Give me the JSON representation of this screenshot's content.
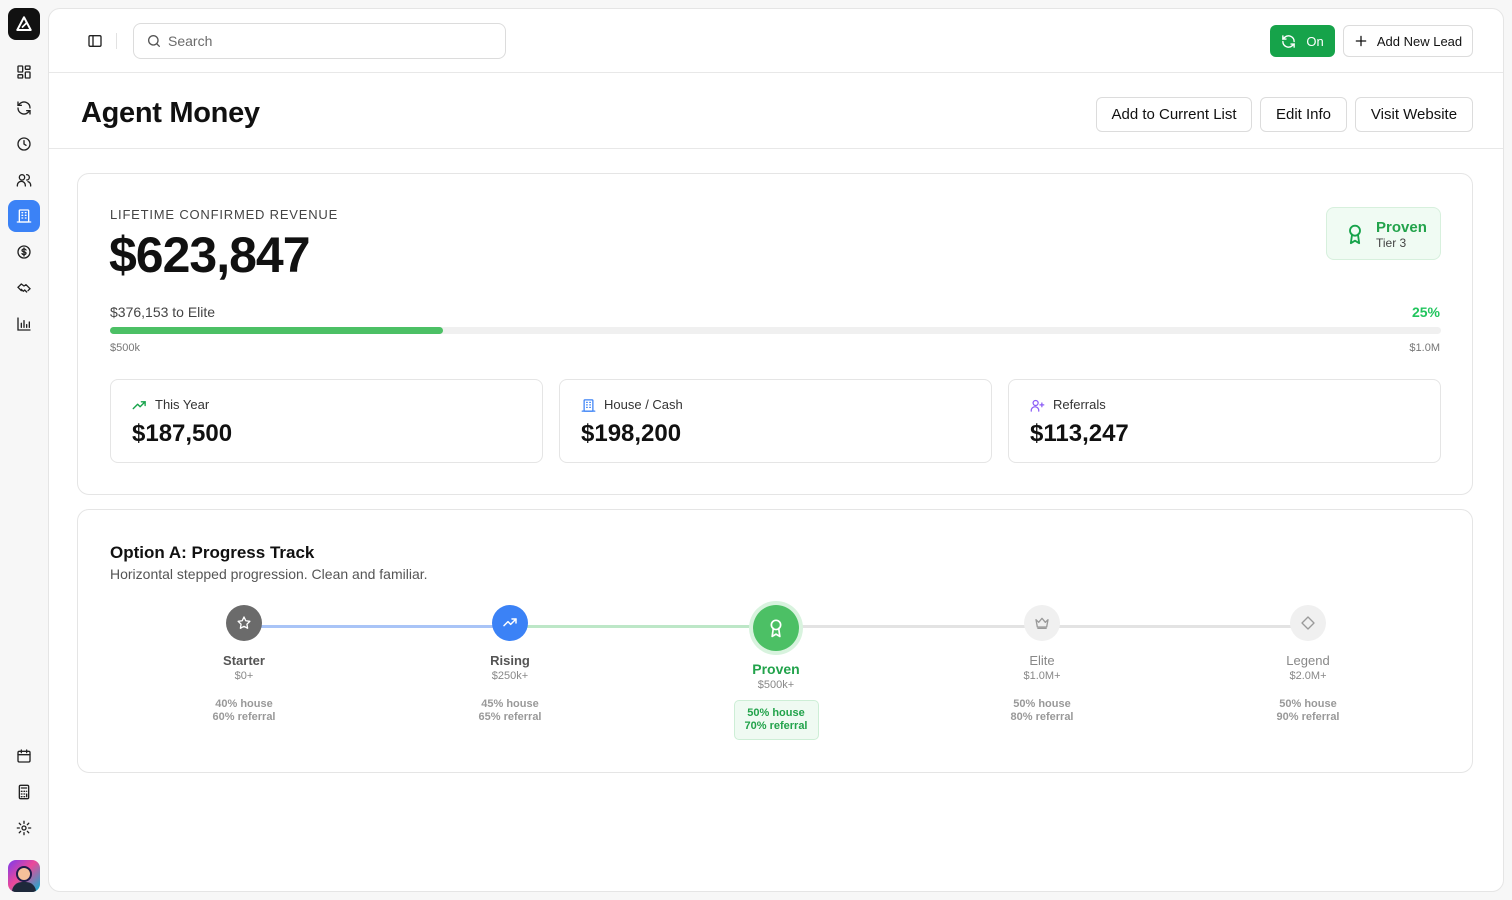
{
  "colors": {
    "accent": "#3b82f6",
    "success": "#16a34a",
    "progress": "#4cc065"
  },
  "sidebar": {
    "items": [
      {
        "icon": "dashboard-icon",
        "active": false
      },
      {
        "icon": "refresh-icon",
        "active": false
      },
      {
        "icon": "clock-icon",
        "active": false
      },
      {
        "icon": "users-icon",
        "active": false
      },
      {
        "icon": "building-icon",
        "active": true
      },
      {
        "icon": "dollar-circle-icon",
        "active": false
      },
      {
        "icon": "handshake-icon",
        "active": false
      },
      {
        "icon": "bar-chart-icon",
        "active": false
      },
      {
        "icon": "calendar-icon",
        "active": false
      },
      {
        "icon": "calculator-icon",
        "active": false
      },
      {
        "icon": "settings-icon",
        "active": false
      }
    ]
  },
  "topbar": {
    "search_placeholder": "Search",
    "sync_label": "On",
    "add_lead_label": "Add New Lead"
  },
  "header": {
    "title": "Agent Money",
    "actions": [
      "Add to Current List",
      "Edit Info",
      "Visit Website"
    ]
  },
  "revenue": {
    "label": "LIFETIME CONFIRMED REVENUE",
    "value": "$623,847",
    "badge_title": "Proven",
    "badge_subtitle": "Tier 3",
    "remaining_text": "$376,153 to Elite",
    "progress_percent_text": "25%",
    "progress_fraction": 0.25,
    "range_start": "$500k",
    "range_end": "$1.0M"
  },
  "stats": [
    {
      "label": "This Year",
      "value": "$187,500",
      "icon": "trending-up-icon"
    },
    {
      "label": "House / Cash",
      "value": "$198,200",
      "icon": "building-icon"
    },
    {
      "label": "Referrals",
      "value": "$113,247",
      "icon": "user-plus-icon"
    }
  ],
  "progress_track": {
    "title": "Option A: Progress Track",
    "subtitle": "Horizontal stepped progression. Clean and familiar.",
    "tiers": [
      {
        "name": "Starter",
        "threshold": "$0+",
        "house": "40% house",
        "referral": "60% referral",
        "state": "completed",
        "icon": "star-icon"
      },
      {
        "name": "Rising",
        "threshold": "$250k+",
        "house": "45% house",
        "referral": "65% referral",
        "state": "completed",
        "icon": "trending-up-icon"
      },
      {
        "name": "Proven",
        "threshold": "$500k+",
        "house": "50% house",
        "referral": "70% referral",
        "state": "current",
        "icon": "award-icon"
      },
      {
        "name": "Elite",
        "threshold": "$1.0M+",
        "house": "50% house",
        "referral": "80% referral",
        "state": "locked",
        "icon": "crown-icon"
      },
      {
        "name": "Legend",
        "threshold": "$2.0M+",
        "house": "50% house",
        "referral": "90% referral",
        "state": "locked",
        "icon": "diamond-icon"
      }
    ]
  }
}
